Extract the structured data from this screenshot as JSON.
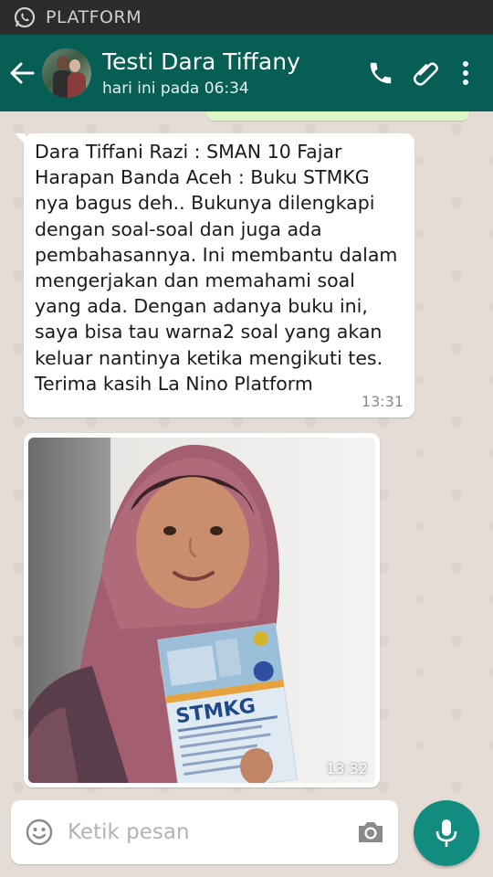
{
  "status_bar": {
    "app_icon": "whatsapp-icon",
    "carrier": "PLATFORM"
  },
  "header": {
    "back_icon": "arrow-left-icon",
    "contact_name": "Testi Dara Tiffany",
    "last_seen": "hari ini pada 06:34",
    "actions": [
      "phone-icon",
      "paperclip-icon",
      "more-vert-icon"
    ]
  },
  "messages": [
    {
      "type": "text",
      "text": "Dara Tiffani Razi : SMAN 10 Fajar Harapan Banda Aceh : Buku STMKG nya bagus deh.. Bukunya dilengkapi dengan soal-soal dan juga ada pembahasannya. Ini membantu dalam mengerjakan dan memahami soal yang ada. Dengan adanya buku ini, saya bisa tau warna2 soal yang akan keluar nantinya ketika mengikuti tes. Terima kasih La Nino Platform",
      "time": "13:31"
    },
    {
      "type": "image",
      "time": "13:32"
    }
  ],
  "photo": {
    "book_title": "STMKG"
  },
  "composer": {
    "emoji_icon": "emoji-icon",
    "placeholder": "Ketik pesan",
    "camera_icon": "camera-icon",
    "mic_icon": "microphone-icon"
  },
  "colors": {
    "header": "#075e54",
    "mic_button": "#128c7e",
    "outgoing_bubble": "#dcf8c6",
    "chat_background": "#e5ddd5"
  }
}
